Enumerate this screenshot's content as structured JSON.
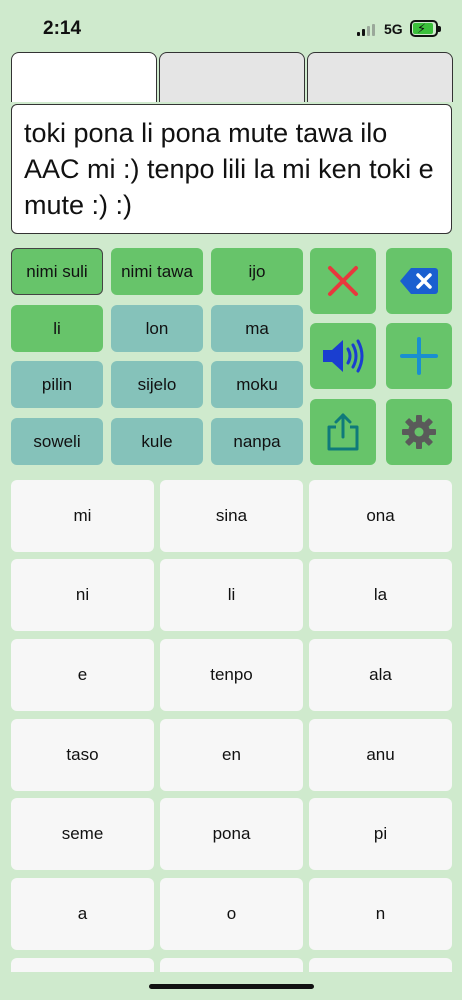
{
  "status_bar": {
    "time": "2:14",
    "network": "5G",
    "battery_icon": "battery-charging-icon",
    "signal_icon": "signal-bars-icon"
  },
  "tabs": [
    {
      "label": "",
      "active": true
    },
    {
      "label": "",
      "active": false
    },
    {
      "label": "",
      "active": false
    }
  ],
  "message": {
    "text": "toki pona li pona mute tawa ilo AAC mi :) tenpo lili la mi ken toki e mute :) :)"
  },
  "categories": [
    {
      "label": "nimi suli",
      "color": "#67c46a",
      "selected": true
    },
    {
      "label": "nimi tawa",
      "color": "#67c46a",
      "selected": false
    },
    {
      "label": "ijo",
      "color": "#67c46a",
      "selected": false
    },
    {
      "label": "li",
      "color": "#67c46a",
      "selected": false
    },
    {
      "label": "lon",
      "color": "#85c2ba",
      "selected": false
    },
    {
      "label": "ma",
      "color": "#85c2ba",
      "selected": false
    },
    {
      "label": "pilin",
      "color": "#85c2ba",
      "selected": false
    },
    {
      "label": "sijelo",
      "color": "#85c2ba",
      "selected": false
    },
    {
      "label": "moku",
      "color": "#85c2ba",
      "selected": false
    },
    {
      "label": "soweli",
      "color": "#85c2ba",
      "selected": false
    },
    {
      "label": "kule",
      "color": "#85c2ba",
      "selected": false
    },
    {
      "label": "nanpa",
      "color": "#85c2ba",
      "selected": false
    }
  ],
  "actions": {
    "clear_icon": "close-icon",
    "backspace_icon": "backspace-icon",
    "speak_icon": "speaker-icon",
    "add_icon": "plus-icon",
    "share_icon": "share-icon",
    "settings_icon": "gear-icon"
  },
  "words": [
    "mi",
    "sina",
    "ona",
    "ni",
    "li",
    "la",
    "e",
    "tenpo",
    "ala",
    "taso",
    "en",
    "anu",
    "seme",
    "pona",
    "pi",
    "a",
    "o",
    "n"
  ],
  "colors": {
    "background": "#cfeacd",
    "button_green": "#67c46a",
    "button_teal": "#85c2ba",
    "clear_red": "#e8383d",
    "icon_blue": "#1a5fd0",
    "settings_gray": "#5a5a5a"
  }
}
